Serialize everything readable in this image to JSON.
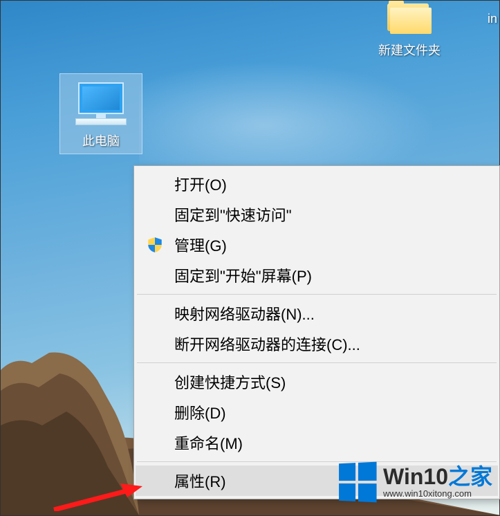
{
  "desktop": {
    "icons": {
      "this_pc": {
        "label": "此电脑",
        "selected": true
      },
      "new_folder": {
        "label": "新建文件夹"
      },
      "partial_right": {
        "label": "in"
      }
    }
  },
  "context_menu": {
    "items": [
      {
        "label": "打开(O)"
      },
      {
        "label": "固定到\"快速访问\""
      },
      {
        "label": "管理(G)",
        "icon": "shield"
      },
      {
        "label": "固定到\"开始\"屏幕(P)"
      }
    ],
    "items2": [
      {
        "label": "映射网络驱动器(N)..."
      },
      {
        "label": "断开网络驱动器的连接(C)..."
      }
    ],
    "items3": [
      {
        "label": "创建快捷方式(S)"
      },
      {
        "label": "删除(D)"
      },
      {
        "label": "重命名(M)"
      }
    ],
    "items4": [
      {
        "label": "属性(R)",
        "highlighted": true
      }
    ]
  },
  "watermark": {
    "title_main": "Win10",
    "title_accent": "之家",
    "subtitle": "www.win10xitong.com"
  }
}
